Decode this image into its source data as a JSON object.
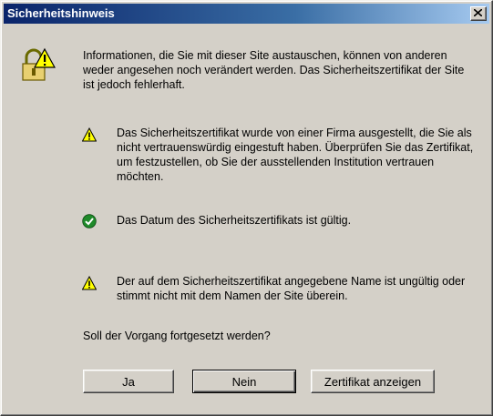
{
  "window": {
    "title": "Sicherheitshinweis"
  },
  "intro": "Informationen, die Sie mit dieser Site austauschen, können von anderen weder angesehen noch verändert werden. Das Sicherheitszertifikat der Site ist jedoch fehlerhaft.",
  "items": [
    {
      "icon": "warning-icon",
      "text": "Das Sicherheitszertifikat wurde von einer Firma ausgestellt, die Sie als nicht vertrauenswürdig eingestuft haben. Überprüfen Sie das Zertifikat, um festzustellen, ob Sie der ausstellenden Institution vertrauen möchten."
    },
    {
      "icon": "ok-check-icon",
      "text": "Das Datum des Sicherheitszertifikats ist gültig."
    },
    {
      "icon": "warning-icon",
      "text": "Der auf dem Sicherheitszertifikat angegebene Name ist ungültig oder stimmt nicht mit dem Namen der Site überein."
    }
  ],
  "question": "Soll der Vorgang fortgesetzt werden?",
  "buttons": {
    "yes": "Ja",
    "no": "Nein",
    "view_cert": "Zertifikat anzeigen"
  },
  "colors": {
    "titlebar_start": "#0a246a",
    "titlebar_end": "#a6caf0",
    "face": "#d4d0c8",
    "warning": "#ffff00",
    "ok": "#1f8a2a"
  }
}
